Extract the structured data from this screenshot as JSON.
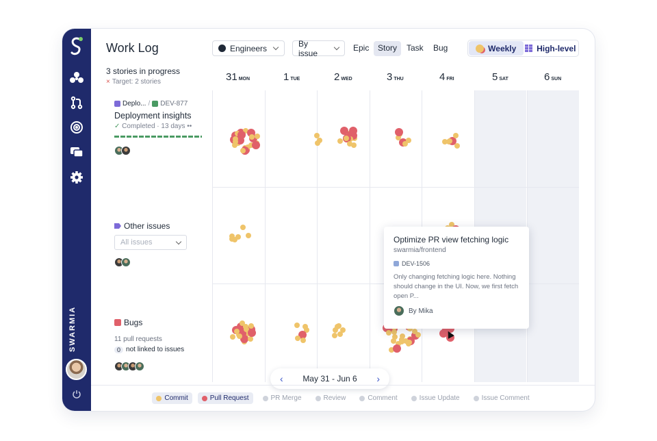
{
  "app": {
    "title": "Work Log",
    "brand": "SWARMIA",
    "sidebar_icons": [
      "swarmia-logo-icon",
      "pinwheel-icon",
      "pull-request-icon",
      "target-icon",
      "chat-icon",
      "gear-icon",
      "power-icon"
    ]
  },
  "toolbar": {
    "team_select": "Engineers",
    "group_select": "By issue",
    "filters": [
      "Epic",
      "Story",
      "Task",
      "Bug"
    ],
    "active_filter": "Story",
    "view_weekly": "Weekly",
    "view_highlevel": "High-level"
  },
  "summary": {
    "in_progress": "3 stories in progress",
    "target": "Target: 2 stories"
  },
  "days": [
    {
      "num": "31",
      "label": "MON"
    },
    {
      "num": "1",
      "label": "TUE"
    },
    {
      "num": "2",
      "label": "WED"
    },
    {
      "num": "3",
      "label": "THU"
    },
    {
      "num": "4",
      "label": "FRI"
    },
    {
      "num": "5",
      "label": "SAT"
    },
    {
      "num": "6",
      "label": "SUN"
    }
  ],
  "rows": {
    "story": {
      "epic": "Deplo...",
      "separator": "/",
      "key": "DEV-877",
      "title": "Deployment insights",
      "status": "Completed · 13 days"
    },
    "other": {
      "title": "Other issues",
      "select_placeholder": "All issues"
    },
    "bugs": {
      "title": "Bugs",
      "pr_count": "11 pull requests",
      "unlinked_count": "0",
      "unlinked_label": "not linked to issues"
    }
  },
  "tooltip": {
    "title": "Optimize PR view fetching logic",
    "repo": "swarmia/frontend",
    "key": "DEV-1506",
    "description": "Only changing fetching logic here. Nothing should change in the UI. Now, we first fetch open P...",
    "author": "By Mika"
  },
  "pager": {
    "range": "May 31 - Jun 6",
    "prev": "‹",
    "next": "›"
  },
  "legend": [
    {
      "label": "Commit",
      "color": "#efc46a",
      "active": true
    },
    {
      "label": "Pull Request",
      "color": "#e0606a",
      "active": true
    },
    {
      "label": "PR Merge",
      "color": "#cfd3db",
      "active": false
    },
    {
      "label": "Review",
      "color": "#cfd3db",
      "active": false
    },
    {
      "label": "Comment",
      "color": "#cfd3db",
      "active": false
    },
    {
      "label": "Issue Update",
      "color": "#cfd3db",
      "active": false
    },
    {
      "label": "Issue Comment",
      "color": "#cfd3db",
      "active": false
    }
  ],
  "colors": {
    "sidebar": "#1f2a6b",
    "commit": "#efc46a",
    "pull_request": "#e0606a",
    "completed": "#4a9a63"
  }
}
